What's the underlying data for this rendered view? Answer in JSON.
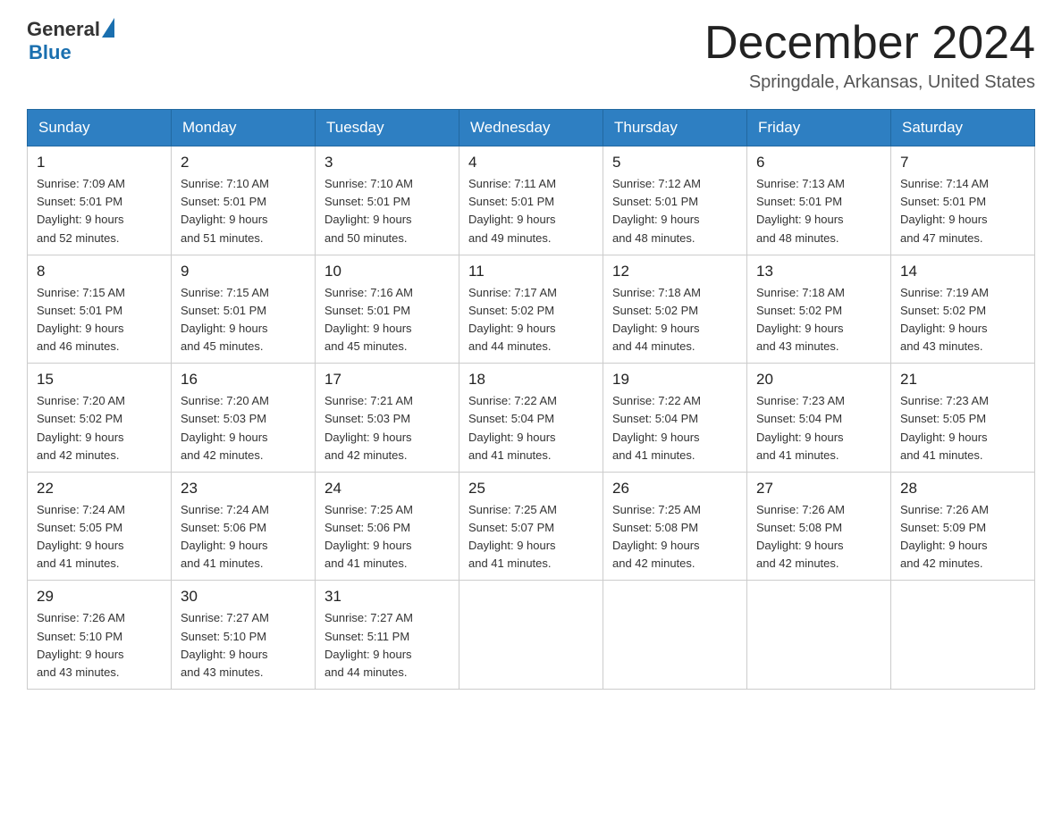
{
  "header": {
    "logo_general": "General",
    "logo_blue": "Blue",
    "month_title": "December 2024",
    "location": "Springdale, Arkansas, United States"
  },
  "weekdays": [
    "Sunday",
    "Monday",
    "Tuesday",
    "Wednesday",
    "Thursday",
    "Friday",
    "Saturday"
  ],
  "weeks": [
    [
      {
        "day": "1",
        "sunrise": "7:09 AM",
        "sunset": "5:01 PM",
        "daylight": "9 hours and 52 minutes."
      },
      {
        "day": "2",
        "sunrise": "7:10 AM",
        "sunset": "5:01 PM",
        "daylight": "9 hours and 51 minutes."
      },
      {
        "day": "3",
        "sunrise": "7:10 AM",
        "sunset": "5:01 PM",
        "daylight": "9 hours and 50 minutes."
      },
      {
        "day": "4",
        "sunrise": "7:11 AM",
        "sunset": "5:01 PM",
        "daylight": "9 hours and 49 minutes."
      },
      {
        "day": "5",
        "sunrise": "7:12 AM",
        "sunset": "5:01 PM",
        "daylight": "9 hours and 48 minutes."
      },
      {
        "day": "6",
        "sunrise": "7:13 AM",
        "sunset": "5:01 PM",
        "daylight": "9 hours and 48 minutes."
      },
      {
        "day": "7",
        "sunrise": "7:14 AM",
        "sunset": "5:01 PM",
        "daylight": "9 hours and 47 minutes."
      }
    ],
    [
      {
        "day": "8",
        "sunrise": "7:15 AM",
        "sunset": "5:01 PM",
        "daylight": "9 hours and 46 minutes."
      },
      {
        "day": "9",
        "sunrise": "7:15 AM",
        "sunset": "5:01 PM",
        "daylight": "9 hours and 45 minutes."
      },
      {
        "day": "10",
        "sunrise": "7:16 AM",
        "sunset": "5:01 PM",
        "daylight": "9 hours and 45 minutes."
      },
      {
        "day": "11",
        "sunrise": "7:17 AM",
        "sunset": "5:02 PM",
        "daylight": "9 hours and 44 minutes."
      },
      {
        "day": "12",
        "sunrise": "7:18 AM",
        "sunset": "5:02 PM",
        "daylight": "9 hours and 44 minutes."
      },
      {
        "day": "13",
        "sunrise": "7:18 AM",
        "sunset": "5:02 PM",
        "daylight": "9 hours and 43 minutes."
      },
      {
        "day": "14",
        "sunrise": "7:19 AM",
        "sunset": "5:02 PM",
        "daylight": "9 hours and 43 minutes."
      }
    ],
    [
      {
        "day": "15",
        "sunrise": "7:20 AM",
        "sunset": "5:02 PM",
        "daylight": "9 hours and 42 minutes."
      },
      {
        "day": "16",
        "sunrise": "7:20 AM",
        "sunset": "5:03 PM",
        "daylight": "9 hours and 42 minutes."
      },
      {
        "day": "17",
        "sunrise": "7:21 AM",
        "sunset": "5:03 PM",
        "daylight": "9 hours and 42 minutes."
      },
      {
        "day": "18",
        "sunrise": "7:22 AM",
        "sunset": "5:04 PM",
        "daylight": "9 hours and 41 minutes."
      },
      {
        "day": "19",
        "sunrise": "7:22 AM",
        "sunset": "5:04 PM",
        "daylight": "9 hours and 41 minutes."
      },
      {
        "day": "20",
        "sunrise": "7:23 AM",
        "sunset": "5:04 PM",
        "daylight": "9 hours and 41 minutes."
      },
      {
        "day": "21",
        "sunrise": "7:23 AM",
        "sunset": "5:05 PM",
        "daylight": "9 hours and 41 minutes."
      }
    ],
    [
      {
        "day": "22",
        "sunrise": "7:24 AM",
        "sunset": "5:05 PM",
        "daylight": "9 hours and 41 minutes."
      },
      {
        "day": "23",
        "sunrise": "7:24 AM",
        "sunset": "5:06 PM",
        "daylight": "9 hours and 41 minutes."
      },
      {
        "day": "24",
        "sunrise": "7:25 AM",
        "sunset": "5:06 PM",
        "daylight": "9 hours and 41 minutes."
      },
      {
        "day": "25",
        "sunrise": "7:25 AM",
        "sunset": "5:07 PM",
        "daylight": "9 hours and 41 minutes."
      },
      {
        "day": "26",
        "sunrise": "7:25 AM",
        "sunset": "5:08 PM",
        "daylight": "9 hours and 42 minutes."
      },
      {
        "day": "27",
        "sunrise": "7:26 AM",
        "sunset": "5:08 PM",
        "daylight": "9 hours and 42 minutes."
      },
      {
        "day": "28",
        "sunrise": "7:26 AM",
        "sunset": "5:09 PM",
        "daylight": "9 hours and 42 minutes."
      }
    ],
    [
      {
        "day": "29",
        "sunrise": "7:26 AM",
        "sunset": "5:10 PM",
        "daylight": "9 hours and 43 minutes."
      },
      {
        "day": "30",
        "sunrise": "7:27 AM",
        "sunset": "5:10 PM",
        "daylight": "9 hours and 43 minutes."
      },
      {
        "day": "31",
        "sunrise": "7:27 AM",
        "sunset": "5:11 PM",
        "daylight": "9 hours and 44 minutes."
      },
      null,
      null,
      null,
      null
    ]
  ],
  "labels": {
    "sunrise": "Sunrise: ",
    "sunset": "Sunset: ",
    "daylight": "Daylight: "
  }
}
